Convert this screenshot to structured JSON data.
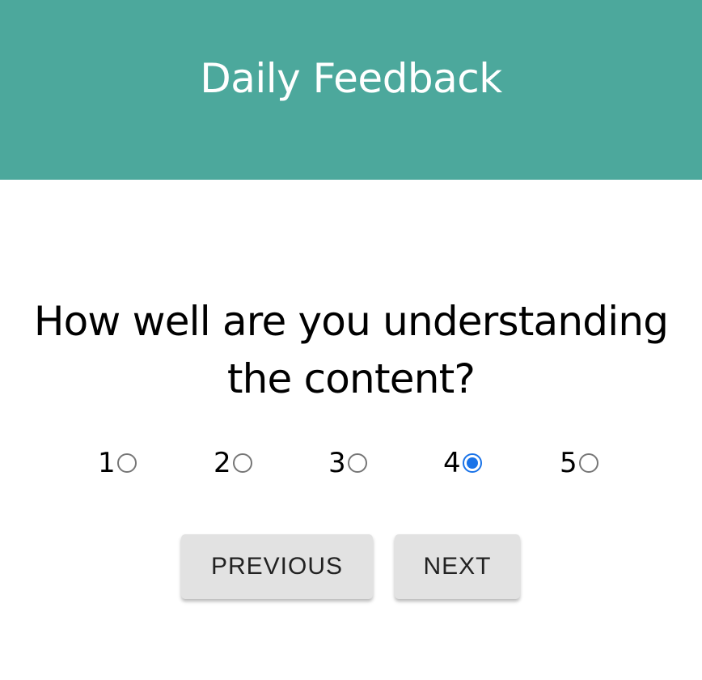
{
  "header": {
    "title": "Daily Feedback",
    "background_color": "#4ca89c"
  },
  "question": {
    "line1": "How well are you understanding",
    "line2": "the content?"
  },
  "rating": {
    "options": [
      {
        "label": "1",
        "checked": false
      },
      {
        "label": "2",
        "checked": false
      },
      {
        "label": "3",
        "checked": false
      },
      {
        "label": "4",
        "checked": true
      },
      {
        "label": "5",
        "checked": false
      }
    ],
    "selected": "4",
    "accent_color": "#1a73e8"
  },
  "buttons": {
    "previous_label": "PREVIOUS",
    "next_label": "NEXT"
  }
}
